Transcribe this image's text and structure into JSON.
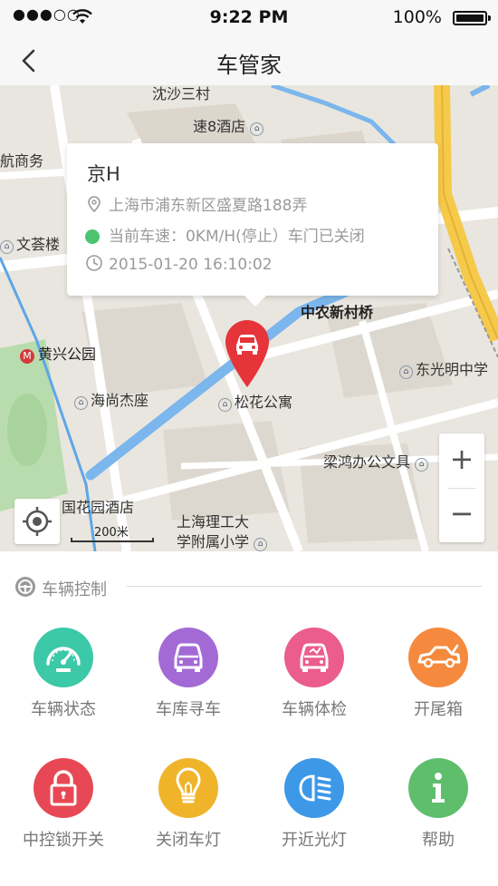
{
  "status_bar": {
    "signal": "●●●○○",
    "time": "9:22 PM",
    "battery": "100%"
  },
  "nav": {
    "title": "车管家"
  },
  "map": {
    "labels": {
      "hotel_top": "速8酒店",
      "commerce": "航商务",
      "wenyunlou": "文荟楼",
      "zhongnong": "中农新村桥",
      "huangxing": "黄兴公园",
      "dongguangming": "东光明中学",
      "haishang": "海尚杰座",
      "songhua": "松花公寓",
      "lianghong": "梁鸿办公文具",
      "garden_hotel": "国花园酒店",
      "school_1": "上海理工大",
      "school_2": "学附属小学",
      "top_road": "沈沙三村"
    },
    "scale": "200米",
    "zoom_in": "+",
    "zoom_out": "−"
  },
  "car_info": {
    "plate": "京H",
    "address": "上海市浦东新区盛夏路188弄",
    "status": "当前车速：0KM/H(停止）车门已关闭",
    "time": "2015-01-20  16:10:02"
  },
  "control": {
    "title": "车辆控制",
    "items": [
      {
        "label": "车辆状态",
        "color": "#3bc9a8",
        "icon": "speedometer-icon"
      },
      {
        "label": "车库寻车",
        "color": "#a36ad6",
        "icon": "car-front-icon"
      },
      {
        "label": "车辆体检",
        "color": "#ea5d8c",
        "icon": "car-check-icon"
      },
      {
        "label": "开尾箱",
        "color": "#f58a3e",
        "icon": "car-side-icon"
      },
      {
        "label": "中控锁开关",
        "color": "#e84855",
        "icon": "lock-icon"
      },
      {
        "label": "关闭车灯",
        "color": "#f0b42b",
        "icon": "bulb-icon"
      },
      {
        "label": "开近光灯",
        "color": "#3d98e8",
        "icon": "headlight-icon"
      },
      {
        "label": "帮助",
        "color": "#5fbe6c",
        "icon": "info-icon"
      }
    ]
  }
}
